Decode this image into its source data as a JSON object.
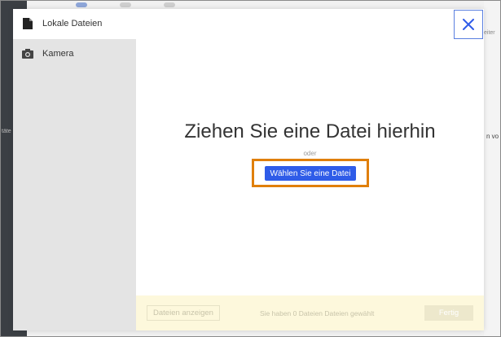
{
  "background": {
    "right_edge_top": "eiter",
    "left_edge_text": "täte",
    "right_edge_text": "n vo"
  },
  "header": {
    "title": "Lokale Dateien",
    "icon": "document-icon",
    "close_icon": "close-icon"
  },
  "sidebar": {
    "items": [
      {
        "label": "Kamera",
        "icon": "camera-icon"
      }
    ]
  },
  "main": {
    "drop_title": "Ziehen Sie eine Datei hierhin",
    "or_text": "oder",
    "choose_button": "Wählen Sie eine Datei"
  },
  "footer": {
    "show_button": "Dateien anzeigen",
    "status": "Sie haben 0 Dateien Dateien gewählt",
    "done_button": "Fertig"
  },
  "colors": {
    "accent": "#2f5ce8",
    "highlight": "#e07f0b",
    "footer_bg": "#fdf8dc",
    "sidebar_bg": "#e4e4e4"
  }
}
